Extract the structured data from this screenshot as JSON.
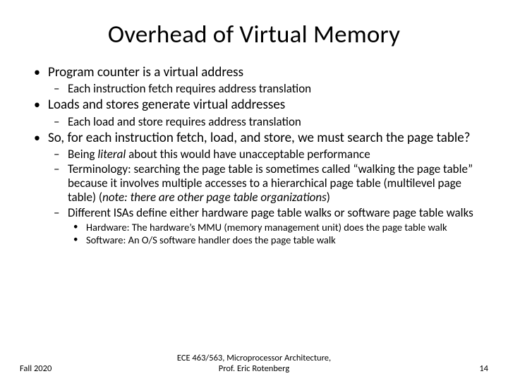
{
  "title": "Overhead of Virtual Memory",
  "bullets": {
    "b1": "Program counter is a virtual address",
    "b1_1": "Each instruction fetch requires address translation",
    "b2": "Loads and stores generate virtual addresses",
    "b2_1": "Each load and store requires address translation",
    "b3": "So, for each instruction fetch, load, and store, we must search the page table?",
    "b3_1_pre": "Being ",
    "b3_1_em": "literal",
    "b3_1_post": " about this would have unacceptable performance",
    "b3_2_pre": "Terminology: searching the page table is sometimes called “walking the page table” because it involves multiple accesses to a hierarchical page table (multilevel page table) (",
    "b3_2_em": "note: there are other page table organizations",
    "b3_2_post": ")",
    "b3_3": "Different ISAs define either hardware page table walks or software page table walks",
    "b3_3_1": "Hardware: The hardware’s MMU (memory management unit) does the page table walk",
    "b3_3_2": "Software: An O/S software handler does the page table walk"
  },
  "footer": {
    "left": "Fall 2020",
    "center_line1": "ECE 463/563, Microprocessor Architecture,",
    "center_line2": "Prof. Eric Rotenberg",
    "right": "14"
  }
}
